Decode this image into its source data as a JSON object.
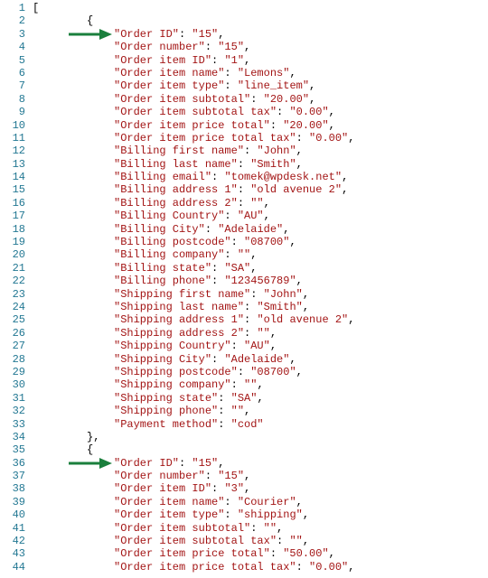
{
  "lines": 44,
  "arrows": [
    3,
    36
  ],
  "code": [
    {
      "n": 1,
      "type": "punct",
      "text": "["
    },
    {
      "n": 2,
      "type": "brace-open",
      "indent": 1
    },
    {
      "n": 3,
      "type": "kv",
      "k": "Order ID",
      "v": "15",
      "c": true
    },
    {
      "n": 4,
      "type": "kv",
      "k": "Order number",
      "v": "15",
      "c": true
    },
    {
      "n": 5,
      "type": "kv",
      "k": "Order item ID",
      "v": "1",
      "c": true
    },
    {
      "n": 6,
      "type": "kv",
      "k": "Order item name",
      "v": "Lemons",
      "c": true
    },
    {
      "n": 7,
      "type": "kv",
      "k": "Order item type",
      "v": "line_item",
      "c": true
    },
    {
      "n": 8,
      "type": "kv",
      "k": "Order item subtotal",
      "v": "20.00",
      "c": true
    },
    {
      "n": 9,
      "type": "kv",
      "k": "Order item subtotal tax",
      "v": "0.00",
      "c": true
    },
    {
      "n": 10,
      "type": "kv",
      "k": "Order item price total",
      "v": "20.00",
      "c": true
    },
    {
      "n": 11,
      "type": "kv",
      "k": "Order item price total tax",
      "v": "0.00",
      "c": true
    },
    {
      "n": 12,
      "type": "kv",
      "k": "Billing first name",
      "v": "John",
      "c": true
    },
    {
      "n": 13,
      "type": "kv",
      "k": "Billing last name",
      "v": "Smith",
      "c": true
    },
    {
      "n": 14,
      "type": "kv",
      "k": "Billing email",
      "v": "tomek@wpdesk.net",
      "c": true
    },
    {
      "n": 15,
      "type": "kv",
      "k": "Billing address 1",
      "v": "old avenue 2",
      "c": true
    },
    {
      "n": 16,
      "type": "kv",
      "k": "Billing address 2",
      "v": "",
      "c": true
    },
    {
      "n": 17,
      "type": "kv",
      "k": "Billing Country",
      "v": "AU",
      "c": true
    },
    {
      "n": 18,
      "type": "kv",
      "k": "Billing City",
      "v": "Adelaide",
      "c": true
    },
    {
      "n": 19,
      "type": "kv",
      "k": "Billing postcode",
      "v": "08700",
      "c": true
    },
    {
      "n": 20,
      "type": "kv",
      "k": "Billing company",
      "v": "",
      "c": true
    },
    {
      "n": 21,
      "type": "kv",
      "k": "Billing state",
      "v": "SA",
      "c": true
    },
    {
      "n": 22,
      "type": "kv",
      "k": "Billing phone",
      "v": "123456789",
      "c": true
    },
    {
      "n": 23,
      "type": "kv",
      "k": "Shipping first name",
      "v": "John",
      "c": true
    },
    {
      "n": 24,
      "type": "kv",
      "k": "Shipping last name",
      "v": "Smith",
      "c": true
    },
    {
      "n": 25,
      "type": "kv",
      "k": "Shipping address 1",
      "v": "old avenue 2",
      "c": true
    },
    {
      "n": 26,
      "type": "kv",
      "k": "Shipping address 2",
      "v": "",
      "c": true
    },
    {
      "n": 27,
      "type": "kv",
      "k": "Shipping Country",
      "v": "AU",
      "c": true
    },
    {
      "n": 28,
      "type": "kv",
      "k": "Shipping City",
      "v": "Adelaide",
      "c": true
    },
    {
      "n": 29,
      "type": "kv",
      "k": "Shipping postcode",
      "v": "08700",
      "c": true
    },
    {
      "n": 30,
      "type": "kv",
      "k": "Shipping company",
      "v": "",
      "c": true
    },
    {
      "n": 31,
      "type": "kv",
      "k": "Shipping state",
      "v": "SA",
      "c": true
    },
    {
      "n": 32,
      "type": "kv",
      "k": "Shipping phone",
      "v": "",
      "c": true
    },
    {
      "n": 33,
      "type": "kv",
      "k": "Payment method",
      "v": "cod",
      "c": false
    },
    {
      "n": 34,
      "type": "brace-close",
      "indent": 1,
      "c": true
    },
    {
      "n": 35,
      "type": "brace-open",
      "indent": 1
    },
    {
      "n": 36,
      "type": "kv",
      "k": "Order ID",
      "v": "15",
      "c": true
    },
    {
      "n": 37,
      "type": "kv",
      "k": "Order number",
      "v": "15",
      "c": true
    },
    {
      "n": 38,
      "type": "kv",
      "k": "Order item ID",
      "v": "3",
      "c": true
    },
    {
      "n": 39,
      "type": "kv",
      "k": "Order item name",
      "v": "Courier",
      "c": true
    },
    {
      "n": 40,
      "type": "kv",
      "k": "Order item type",
      "v": "shipping",
      "c": true
    },
    {
      "n": 41,
      "type": "kv",
      "k": "Order item subtotal",
      "v": "",
      "c": true
    },
    {
      "n": 42,
      "type": "kv",
      "k": "Order item subtotal tax",
      "v": "",
      "c": true
    },
    {
      "n": 43,
      "type": "kv",
      "k": "Order item price total",
      "v": "50.00",
      "c": true
    },
    {
      "n": 44,
      "type": "kv",
      "k": "Order item price total tax",
      "v": "0.00",
      "c": true
    }
  ]
}
